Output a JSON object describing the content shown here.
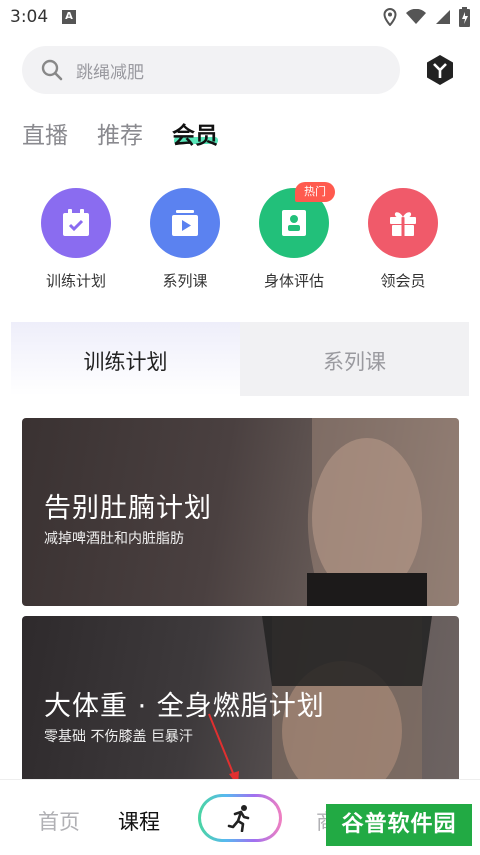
{
  "status": {
    "time": "3:04",
    "notification_letter": "A"
  },
  "search": {
    "placeholder": "跳绳减肥"
  },
  "top_tabs": [
    {
      "label": "直播"
    },
    {
      "label": "推荐"
    },
    {
      "label": "会员",
      "active": true
    }
  ],
  "features": [
    {
      "label": "训练计划",
      "color": "#8a6cf0",
      "icon": "calendar-check-icon"
    },
    {
      "label": "系列课",
      "color": "#5b82f0",
      "icon": "video-play-icon"
    },
    {
      "label": "身体评估",
      "color": "#22c07a",
      "icon": "body-assess-icon",
      "badge": "热门"
    },
    {
      "label": "领会员",
      "color": "#f05a6a",
      "icon": "gift-icon"
    }
  ],
  "segment_tabs": [
    {
      "label": "训练计划",
      "active": true
    },
    {
      "label": "系列课"
    }
  ],
  "cards": [
    {
      "title": "告别肚腩计划",
      "subtitle": "减掉啤酒肚和内脏脂肪"
    },
    {
      "title": "大体重 · 全身燃脂计划",
      "subtitle": "零基础 不伤膝盖 巨暴汗"
    }
  ],
  "bottom_nav": [
    {
      "label": "首页"
    },
    {
      "label": "课程",
      "active": true
    },
    {
      "label": "商"
    }
  ],
  "watermark": "谷普软件园",
  "colors": {
    "accent": "#30e0a8",
    "arrow": "#e03030"
  }
}
